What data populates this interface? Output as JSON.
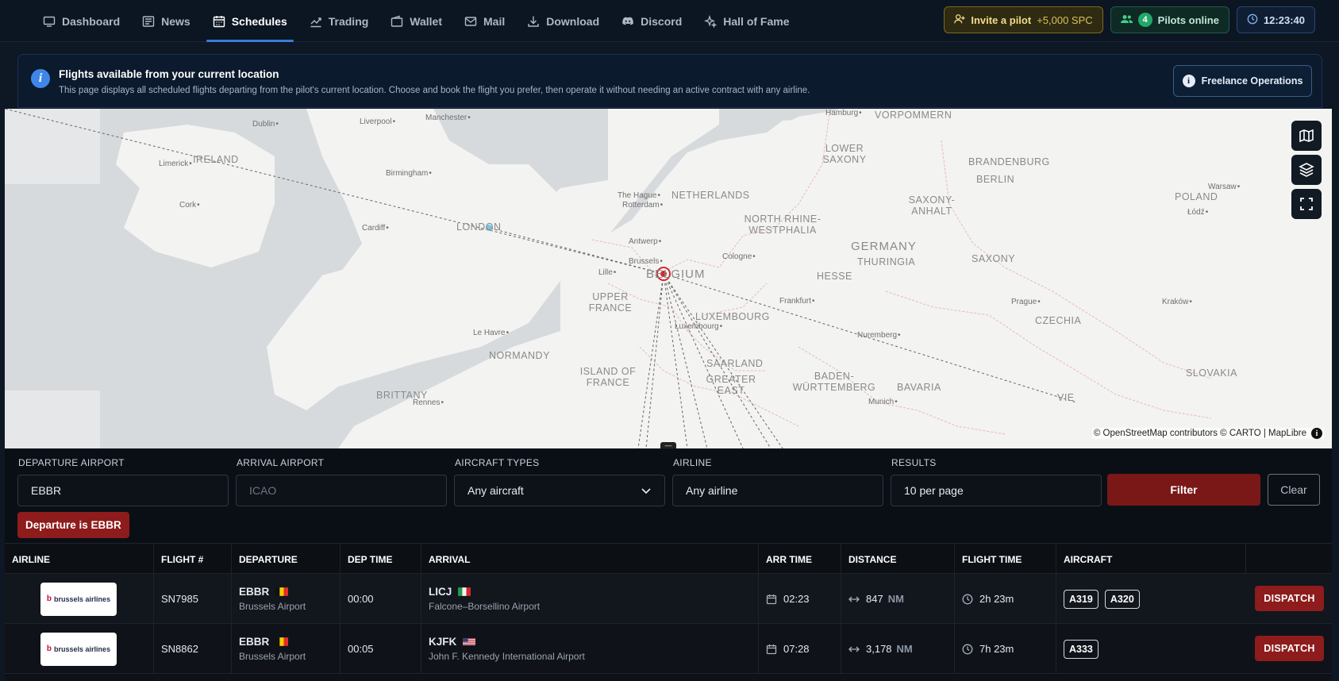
{
  "nav": {
    "items": [
      {
        "label": "Dashboard",
        "icon": "monitor-icon"
      },
      {
        "label": "News",
        "icon": "newspaper-icon"
      },
      {
        "label": "Schedules",
        "icon": "calendar-icon",
        "active": true
      },
      {
        "label": "Trading",
        "icon": "trend-icon"
      },
      {
        "label": "Wallet",
        "icon": "wallet-icon"
      },
      {
        "label": "Mail",
        "icon": "mail-icon"
      },
      {
        "label": "Download",
        "icon": "download-icon"
      },
      {
        "label": "Discord",
        "icon": "discord-icon"
      },
      {
        "label": "Hall of Fame",
        "icon": "sparkle-icon"
      }
    ],
    "invite_label": "Invite a pilot",
    "invite_bonus": "+5,000 SPC",
    "online_count": "4",
    "online_label": "Pilots online",
    "clock": "12:23:40"
  },
  "banner": {
    "title": "Flights available from your current location",
    "description": "This page displays all scheduled flights departing from the pilot's current location. Choose and book the flight you prefer, then operate it without needing an active contract with any airline.",
    "button_label": "Freelance Operations"
  },
  "map": {
    "labels": {
      "ireland": "IRELAND",
      "netherlands": "NETHERLANDS",
      "lower_saxony": "LOWER SAXONY",
      "vorpommern": "VORPOMMERN",
      "brandenburg": "BRANDENBURG",
      "berlin": "BERLIN",
      "poland": "POLAND",
      "saxony_anhalt": "SAXONY-ANHALT",
      "nrw": "NORTH RHINE-WESTPHALIA",
      "germany": "GERMANY",
      "thuringia": "THURINGIA",
      "saxony": "SAXONY",
      "hesse": "HESSE",
      "belgium": "BELGIUM",
      "upper_france": "UPPER FRANCE",
      "luxembourg": "LUXEMBOURG",
      "saarland": "SAARLAND",
      "czechia": "CZECHIA",
      "normandy": "NORMANDY",
      "bavaria": "BAVARIA",
      "slovakia": "SLOVAKIA",
      "island_of_france": "ISLAND OF FRANCE",
      "greater_east": "GREATER EAST",
      "baden": "BADEN-WÜRTTEMBERG",
      "brittany": "BRITTANY",
      "london": "LONDON",
      "vie": "VIE"
    },
    "cities": {
      "dublin": "Dublin",
      "liverpool": "Liverpool",
      "manchester": "Manchester",
      "limerick": "Limerick",
      "birmingham": "Birmingham",
      "cork": "Cork",
      "cardiff": "Cardiff",
      "the_hague": "The Hague",
      "rotterdam": "Rotterdam",
      "antwerp": "Antwerp",
      "brussels": "Brussels",
      "lille": "Lille",
      "cologne": "Cologne",
      "frankfurt": "Frankfurt",
      "luxembourg_c": "Luxembourg",
      "le_havre": "Le Havre",
      "rennes": "Rennes",
      "nuremberg": "Nuremberg",
      "munich": "Munich",
      "prague": "Prague",
      "krakow": "Kraków",
      "warsaw": "Warsaw",
      "lodz": "Łódź",
      "hamburg": "Hamburg"
    },
    "attribution": "© OpenStreetMap contributors © CARTO | MapLibre",
    "colors": {
      "water": "#d6d9dc",
      "land": "#f3f3f2",
      "border": "#e8b7c2",
      "route": "#555555",
      "origin": "#d22a2a"
    }
  },
  "filters": {
    "departure": {
      "label": "DEPARTURE AIRPORT",
      "value": "EBBR"
    },
    "arrival": {
      "label": "ARRIVAL AIRPORT",
      "placeholder": "ICAO"
    },
    "aircraft": {
      "label": "AIRCRAFT TYPES",
      "value": "Any aircraft"
    },
    "airline": {
      "label": "AIRLINE",
      "value": "Any airline"
    },
    "results": {
      "label": "RESULTS",
      "value": "10 per page"
    },
    "filter_label": "Filter",
    "clear_label": "Clear",
    "active_tag": "Departure is EBBR"
  },
  "table": {
    "headers": [
      "AIRLINE",
      "FLIGHT #",
      "DEPARTURE",
      "DEP TIME",
      "ARRIVAL",
      "ARR TIME",
      "DISTANCE",
      "FLIGHT TIME",
      "AIRCRAFT"
    ],
    "rows": [
      {
        "airline": "brussels airlines",
        "flight": "SN7985",
        "dep_code": "EBBR",
        "dep_name": "Brussels Airport",
        "dep_time": "00:00",
        "arr_code": "LICJ",
        "arr_name": "Falcone–Borsellino Airport",
        "arr_time": "02:23",
        "distance": "847",
        "distance_unit": "NM",
        "flight_time": "2h 23m",
        "aircraft": [
          "A319",
          "A320"
        ],
        "action": "DISPATCH"
      },
      {
        "airline": "brussels airlines",
        "flight": "SN8862",
        "dep_code": "EBBR",
        "dep_name": "Brussels Airport",
        "dep_time": "00:05",
        "arr_code": "KJFK",
        "arr_name": "John F. Kennedy International Airport",
        "arr_time": "07:28",
        "distance": "3,178",
        "distance_unit": "NM",
        "flight_time": "7h 23m",
        "aircraft": [
          "A333"
        ],
        "action": "DISPATCH"
      }
    ]
  }
}
